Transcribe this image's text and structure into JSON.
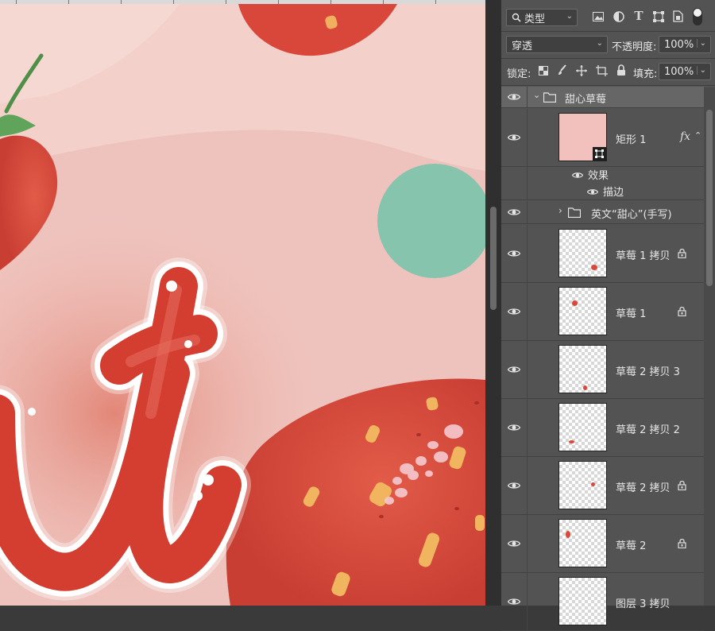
{
  "toolbar": {
    "filter_select": "类型",
    "blend_mode": "穿透",
    "opacity_label": "不透明度:",
    "opacity_value": "100%",
    "lock_label": "锁定:",
    "fill_label": "填充:",
    "fill_value": "100%"
  },
  "layers": {
    "group": {
      "name": "甜心草莓",
      "expanded": true
    },
    "rect": {
      "name": "矩形 1",
      "fx": "fx",
      "thumb_color": "#f2c1be"
    },
    "effects_label": "效果",
    "stroke_label": "描边",
    "subgroup": {
      "name": "英文“甜心”(手写)"
    },
    "items": [
      {
        "name": "草莓 1 拷贝",
        "locked": true
      },
      {
        "name": "草莓 1",
        "locked": true
      },
      {
        "name": "草莓 2 拷贝 3",
        "locked": false
      },
      {
        "name": "草莓 2 拷贝 2",
        "locked": false
      },
      {
        "name": "草莓 2 拷贝",
        "locked": true
      },
      {
        "name": "草莓 2",
        "locked": true
      },
      {
        "name": "图层 3 拷贝",
        "locked": false
      }
    ]
  },
  "colors": {
    "canvas_bg": "#eec8c2",
    "teal_circle": "#86c4ad",
    "strawberry": "#d9483a",
    "panel_bg": "#535353",
    "selected_row": "#666666"
  }
}
